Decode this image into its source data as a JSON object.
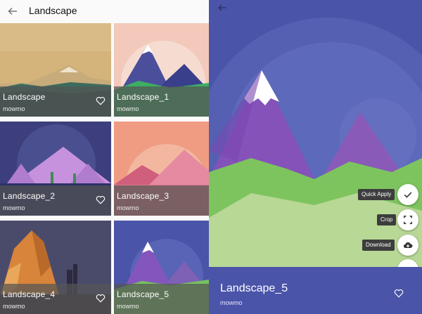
{
  "app_bar": {
    "title": "Landscape"
  },
  "wallpapers": [
    {
      "name": "Landscape",
      "author": "mowmo"
    },
    {
      "name": "Landscape_1",
      "author": "mowmo"
    },
    {
      "name": "Landscape_2",
      "author": "mowmo"
    },
    {
      "name": "Landscape_3",
      "author": "mowmo"
    },
    {
      "name": "Landscape_4",
      "author": "mowmo"
    },
    {
      "name": "Landscape_5",
      "author": "mowmo"
    }
  ],
  "detail": {
    "name": "Landscape_5",
    "author": "mowmo",
    "actions": {
      "quick_apply": "Quick Apply",
      "crop": "Crop",
      "download": "Download"
    }
  },
  "colors": {
    "detail_background": "#4a54a8",
    "fab_background": "#ffffff",
    "label_background": "#3d3d3d"
  },
  "icons": [
    "back-arrow-icon",
    "heart-icon",
    "check-icon",
    "crop-icon",
    "cloud-download-icon",
    "close-icon"
  ]
}
